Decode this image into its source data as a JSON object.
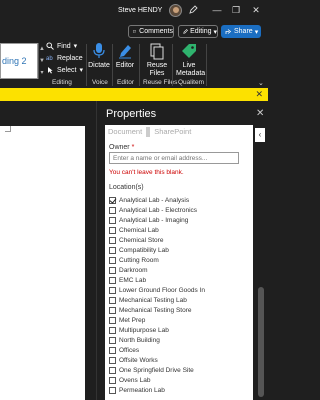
{
  "titlebar": {
    "user_name": "Steve HENDY",
    "minimize_glyph": "—",
    "restore_glyph": "❐",
    "close_glyph": "✕"
  },
  "command_bar": {
    "comments_label": "Comments",
    "editing_label": "Editing",
    "share_label": "Share",
    "caret_glyph": "▾"
  },
  "ribbon": {
    "style_preview": "ding 2",
    "editing_group": {
      "find_label": "Find",
      "replace_label": "Replace",
      "select_label": "Select",
      "group_label": "Editing"
    },
    "voice_group": {
      "dictate_label": "Dictate",
      "group_label": "Voice"
    },
    "editor_group": {
      "editor_label": "Editor",
      "group_label": "Editor"
    },
    "reuse_group": {
      "reuse_label": "Reuse Files",
      "group_label": "Reuse Files"
    },
    "qualitem_group": {
      "live_metadata_label": "Live Metadata",
      "group_label": "Qualitem"
    },
    "accent_color": "#1b6ec2"
  },
  "notice_bar": {
    "close_glyph": "✕",
    "color": "#fce100"
  },
  "properties": {
    "title": "Properties",
    "close_glyph": "✕",
    "collapse_glyph": "‹",
    "tabs": [
      "Document",
      "SharePoint"
    ],
    "owner_label": "Owner",
    "owner_required_mark": "*",
    "owner_placeholder": "Enter a name or email address...",
    "owner_error": "You can't leave this blank.",
    "locations_label": "Location(s)",
    "locations": [
      {
        "label": "Analytical Lab - Analysis",
        "checked": true
      },
      {
        "label": "Analytical Lab - Electronics",
        "checked": false
      },
      {
        "label": "Analytical Lab - Imaging",
        "checked": false
      },
      {
        "label": "Chemical Lab",
        "checked": false
      },
      {
        "label": "Chemical Store",
        "checked": false
      },
      {
        "label": "Compatibility Lab",
        "checked": false
      },
      {
        "label": "Cutting Room",
        "checked": false
      },
      {
        "label": "Darkroom",
        "checked": false
      },
      {
        "label": "EMC Lab",
        "checked": false
      },
      {
        "label": "Lower Ground Floor Goods In",
        "checked": false
      },
      {
        "label": "Mechanical Testing Lab",
        "checked": false
      },
      {
        "label": "Mechanical Testing Store",
        "checked": false
      },
      {
        "label": "Met Prep",
        "checked": false
      },
      {
        "label": "Multipurpose Lab",
        "checked": false
      },
      {
        "label": "North Building",
        "checked": false
      },
      {
        "label": "Offices",
        "checked": false
      },
      {
        "label": "Offsite Works",
        "checked": false
      },
      {
        "label": "One Springfield Drive Site",
        "checked": false
      },
      {
        "label": "Ovens Lab",
        "checked": false
      },
      {
        "label": "Permeation Lab",
        "checked": false
      }
    ]
  }
}
